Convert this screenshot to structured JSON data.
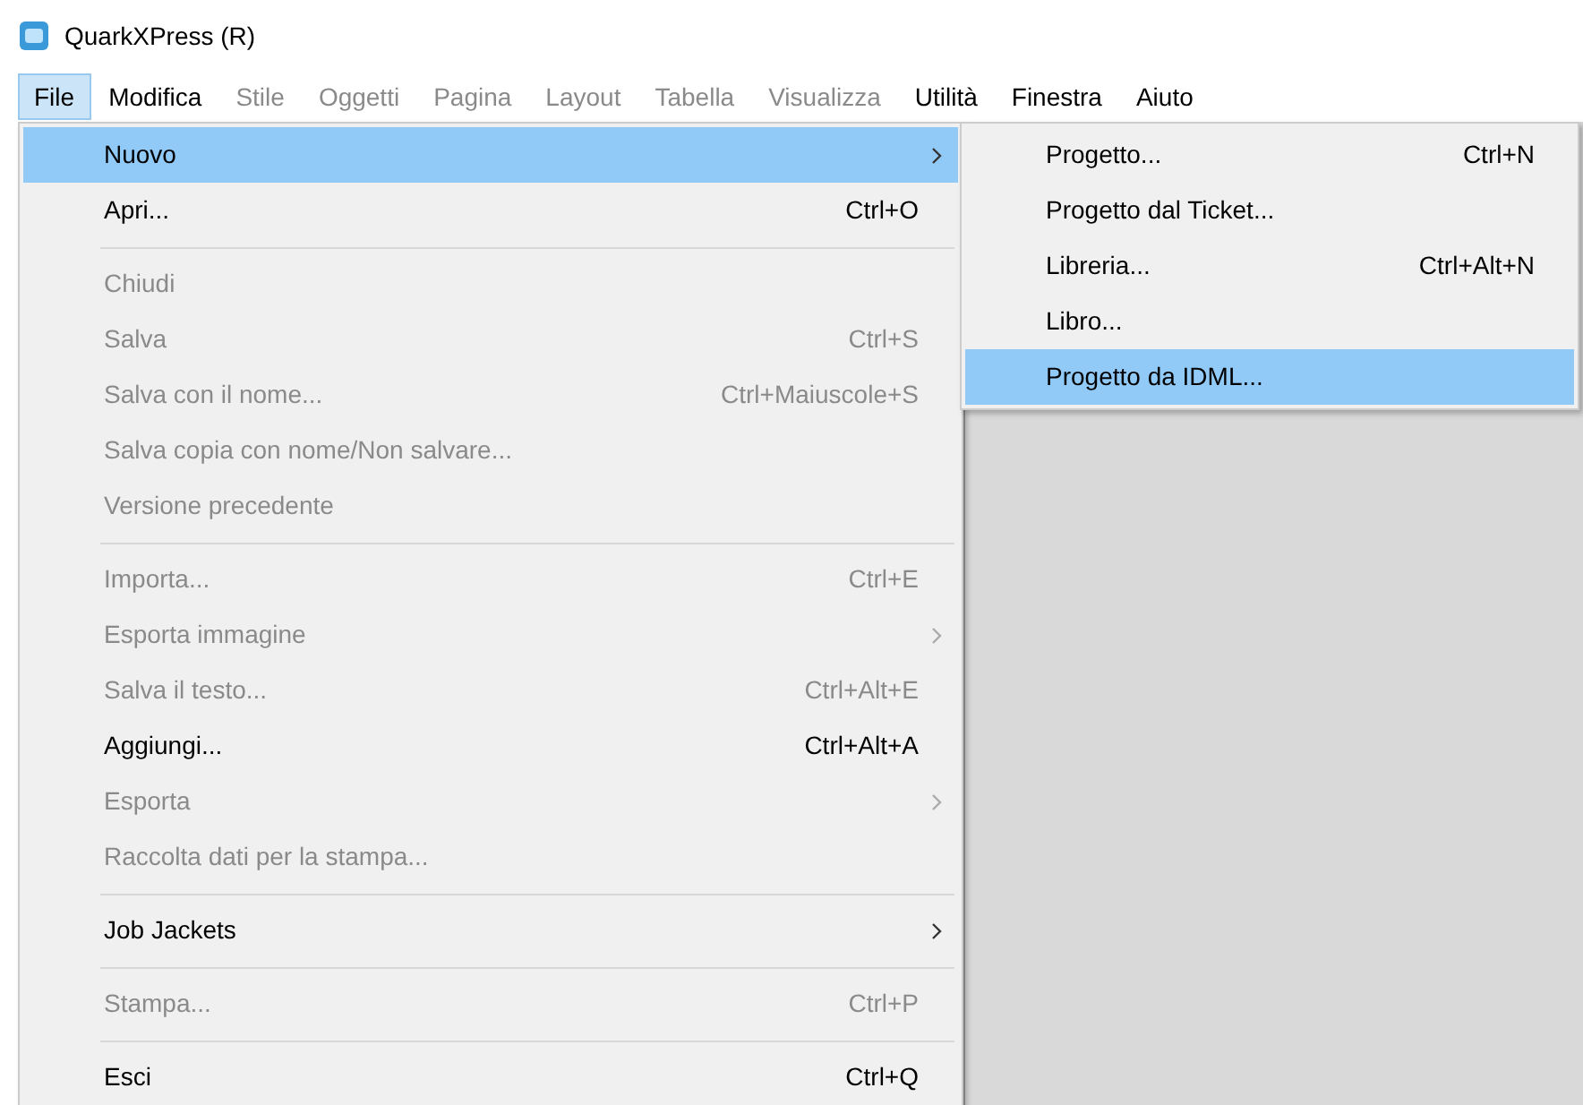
{
  "window": {
    "title": "QuarkXPress (R)"
  },
  "menubar": [
    {
      "label": "File",
      "selected": true,
      "disabled": false
    },
    {
      "label": "Modifica",
      "selected": false,
      "disabled": false
    },
    {
      "label": "Stile",
      "selected": false,
      "disabled": true
    },
    {
      "label": "Oggetti",
      "selected": false,
      "disabled": true
    },
    {
      "label": "Pagina",
      "selected": false,
      "disabled": true
    },
    {
      "label": "Layout",
      "selected": false,
      "disabled": true
    },
    {
      "label": "Tabella",
      "selected": false,
      "disabled": true
    },
    {
      "label": "Visualizza",
      "selected": false,
      "disabled": true
    },
    {
      "label": "Utilità",
      "selected": false,
      "disabled": false
    },
    {
      "label": "Finestra",
      "selected": false,
      "disabled": false
    },
    {
      "label": "Aiuto",
      "selected": false,
      "disabled": false
    }
  ],
  "file_menu": [
    {
      "kind": "item",
      "label": "Nuovo",
      "submenu": true,
      "selected": true,
      "disabled": false
    },
    {
      "kind": "item",
      "label": "Apri...",
      "shortcut": "Ctrl+O",
      "selected": false,
      "disabled": false
    },
    {
      "kind": "separator"
    },
    {
      "kind": "item",
      "label": "Chiudi",
      "selected": false,
      "disabled": true
    },
    {
      "kind": "item",
      "label": "Salva",
      "shortcut": "Ctrl+S",
      "selected": false,
      "disabled": true
    },
    {
      "kind": "item",
      "label": "Salva con il nome...",
      "shortcut": "Ctrl+Maiuscole+S",
      "selected": false,
      "disabled": true
    },
    {
      "kind": "item",
      "label": "Salva copia con nome/Non salvare...",
      "selected": false,
      "disabled": true
    },
    {
      "kind": "item",
      "label": "Versione precedente",
      "selected": false,
      "disabled": true
    },
    {
      "kind": "separator"
    },
    {
      "kind": "item",
      "label": "Importa...",
      "shortcut": "Ctrl+E",
      "selected": false,
      "disabled": true
    },
    {
      "kind": "item",
      "label": "Esporta immagine",
      "submenu": true,
      "selected": false,
      "disabled": true
    },
    {
      "kind": "item",
      "label": "Salva il testo...",
      "shortcut": "Ctrl+Alt+E",
      "selected": false,
      "disabled": true
    },
    {
      "kind": "item",
      "label": "Aggiungi...",
      "shortcut": "Ctrl+Alt+A",
      "selected": false,
      "disabled": false
    },
    {
      "kind": "item",
      "label": "Esporta",
      "submenu": true,
      "selected": false,
      "disabled": true
    },
    {
      "kind": "item",
      "label": "Raccolta dati per la stampa...",
      "selected": false,
      "disabled": true
    },
    {
      "kind": "separator"
    },
    {
      "kind": "item",
      "label": "Job Jackets",
      "submenu": true,
      "selected": false,
      "disabled": false
    },
    {
      "kind": "separator"
    },
    {
      "kind": "item",
      "label": "Stampa...",
      "shortcut": "Ctrl+P",
      "selected": false,
      "disabled": true
    },
    {
      "kind": "separator"
    },
    {
      "kind": "item",
      "label": "Esci",
      "shortcut": "Ctrl+Q",
      "selected": false,
      "disabled": false
    }
  ],
  "nuovo_submenu": [
    {
      "kind": "item",
      "label": "Progetto...",
      "shortcut": "Ctrl+N",
      "selected": false,
      "disabled": false
    },
    {
      "kind": "item",
      "label": "Progetto dal Ticket...",
      "selected": false,
      "disabled": false
    },
    {
      "kind": "item",
      "label": "Libreria...",
      "shortcut": "Ctrl+Alt+N",
      "selected": false,
      "disabled": false
    },
    {
      "kind": "item",
      "label": "Libro...",
      "selected": false,
      "disabled": false
    },
    {
      "kind": "item",
      "label": "Progetto da IDML...",
      "selected": true,
      "disabled": false
    }
  ]
}
